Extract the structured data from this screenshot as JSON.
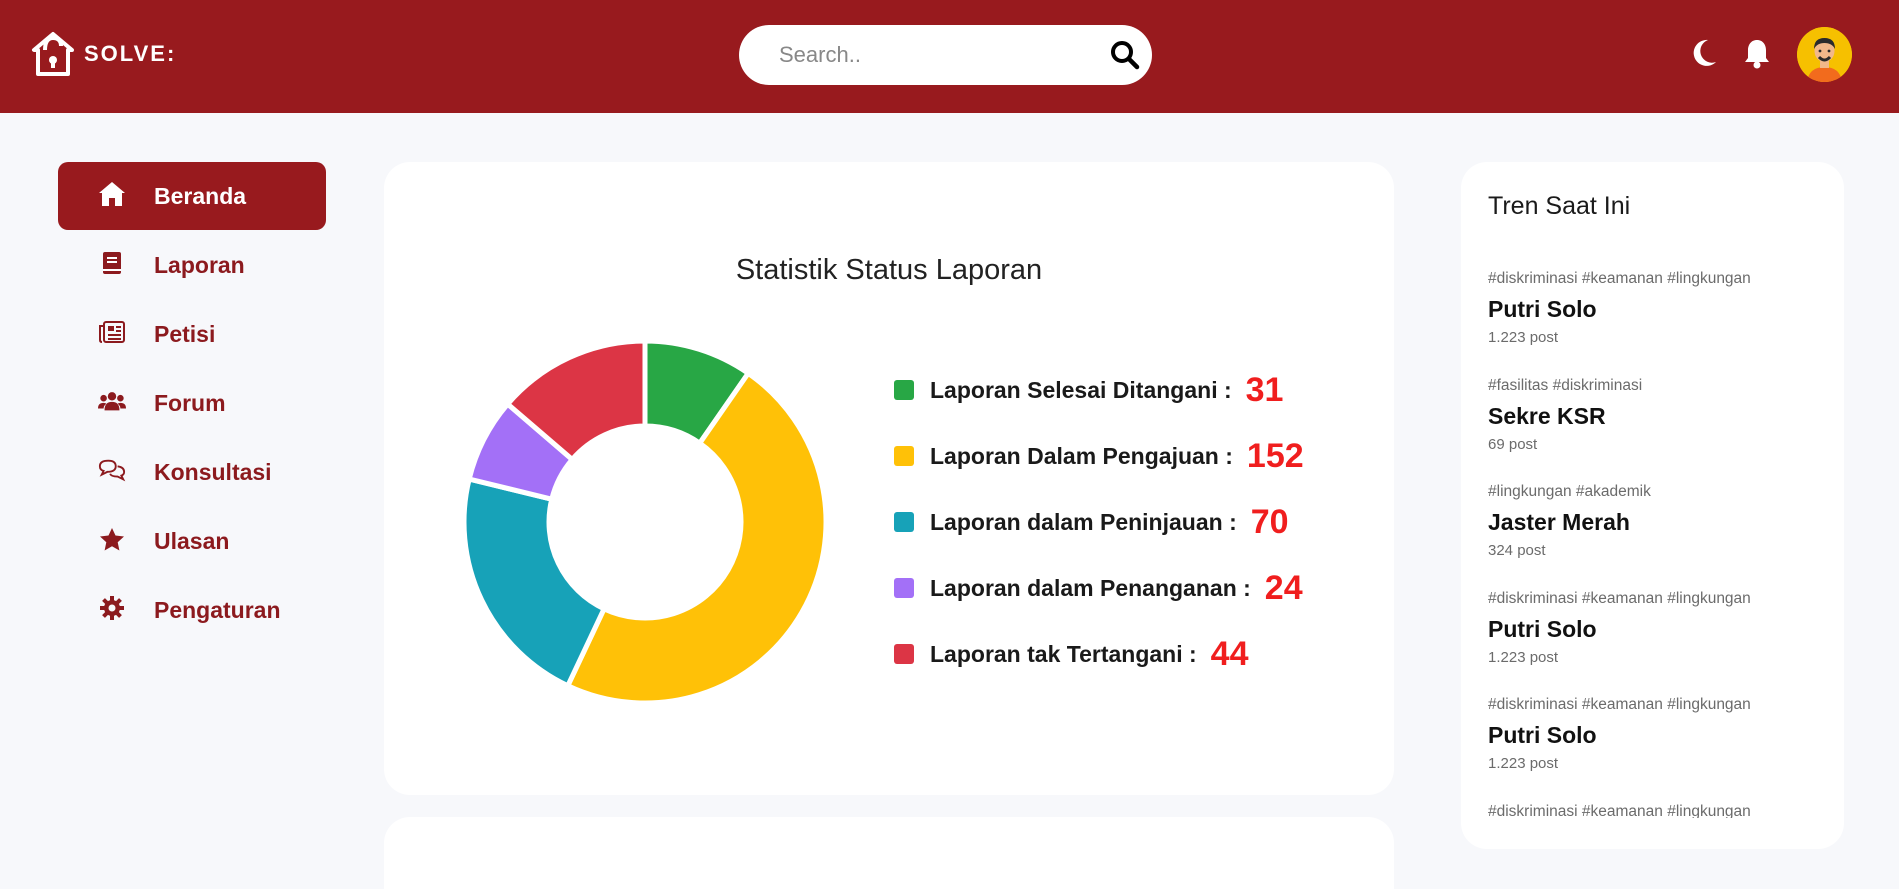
{
  "header": {
    "brand": "SOLVE:",
    "search_placeholder": "Search..",
    "icons": [
      "moon-icon",
      "bell-icon",
      "avatar"
    ]
  },
  "colors": {
    "primary": "#981a1e",
    "background": "#f7f8fb",
    "value_red": "#f01e1e"
  },
  "sidebar": {
    "items": [
      {
        "label": "Beranda",
        "icon": "home-icon",
        "active": true
      },
      {
        "label": "Laporan",
        "icon": "book-icon"
      },
      {
        "label": "Petisi",
        "icon": "newspaper-icon"
      },
      {
        "label": "Forum",
        "icon": "users-icon"
      },
      {
        "label": "Konsultasi",
        "icon": "chat-icon"
      },
      {
        "label": "Ulasan",
        "icon": "star-icon"
      },
      {
        "label": "Pengaturan",
        "icon": "gear-icon"
      }
    ]
  },
  "stats": {
    "title": "Statistik Status Laporan",
    "legend": [
      {
        "label": "Laporan Selesai Ditangani :",
        "value": "31",
        "color": "#28a745"
      },
      {
        "label": "Laporan Dalam Pengajuan :",
        "value": "152",
        "color": "#ffc107"
      },
      {
        "label": "Laporan dalam Peninjauan :",
        "value": "70",
        "color": "#17a2b8"
      },
      {
        "label": "Laporan dalam Penanganan :",
        "value": "24",
        "color": "#a370f7"
      },
      {
        "label": "Laporan tak Tertangani :",
        "value": "44",
        "color": "#dc3545"
      }
    ]
  },
  "chart_data": {
    "type": "pie",
    "title": "Statistik Status Laporan",
    "categories": [
      "Laporan Selesai Ditangani",
      "Laporan Dalam Pengajuan",
      "Laporan dalam Peninjauan",
      "Laporan dalam Penanganan",
      "Laporan tak Tertangani"
    ],
    "values": [
      31,
      152,
      70,
      24,
      44
    ],
    "colors": [
      "#28a745",
      "#ffc107",
      "#17a2b8",
      "#a370f7",
      "#dc3545"
    ],
    "legend": "right"
  },
  "trends": {
    "title": "Tren Saat Ini",
    "items": [
      {
        "tags": "#diskriminasi #keamanan #lingkungan",
        "name": "Putri Solo",
        "count": "1.223 post"
      },
      {
        "tags": "#fasilitas #diskriminasi",
        "name": "Sekre KSR",
        "count": "69 post"
      },
      {
        "tags": "#lingkungan #akademik",
        "name": "Jaster Merah",
        "count": "324 post"
      },
      {
        "tags": "#diskriminasi #keamanan #lingkungan",
        "name": "Putri Solo",
        "count": "1.223 post"
      },
      {
        "tags": "#diskriminasi #keamanan #lingkungan",
        "name": "Putri Solo",
        "count": "1.223 post"
      },
      {
        "tags": "#diskriminasi #keamanan #lingkungan",
        "name": "",
        "count": ""
      }
    ]
  }
}
